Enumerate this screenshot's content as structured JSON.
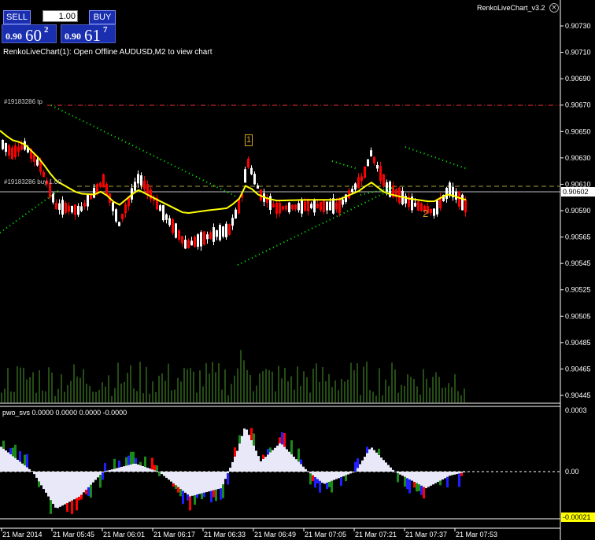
{
  "window": {
    "title": "RenkoLiveChart_v3.2",
    "close_icon": "close-icon"
  },
  "trade_panel": {
    "sell_label": "SELL",
    "buy_label": "BUY",
    "lot_value": "1.00",
    "sell_price": {
      "prefix": "0.90",
      "big": "60",
      "sup": "2"
    },
    "buy_price": {
      "prefix": "0.90",
      "big": "61",
      "sup": "7"
    }
  },
  "chart_info": "RenkoLiveChart(1): Open Offline AUDUSD,M2 to view chart",
  "order_labels": {
    "tp": "#19183286 tp",
    "buy": "#19183286 buy 1.00"
  },
  "wave_labels": {
    "one": "1",
    "two": "2"
  },
  "indicator_name": "pwo_svs 0.0000 0.0000 0.0000 -0.0000",
  "colors": {
    "background": "#000000",
    "bull": "#ffffff",
    "bear": "#ff0000",
    "ma": "#ffff00",
    "dots": "#00ff00",
    "tp_line": "#ff3030",
    "buy_line": "#b0a030",
    "current_price": "#ffffff",
    "volume": "#4a9a2a",
    "osc_body": "#e8e8f8",
    "osc_red": "#ff0000",
    "osc_blue": "#1f1fff",
    "osc_green": "#1a8a1a"
  },
  "chart_data": {
    "type": "candlestick",
    "ylim": [
      0.90445,
      0.9073
    ],
    "y_ticks": [
      "0.90730",
      "0.90710",
      "0.90690",
      "0.90670",
      "0.90650",
      "0.90630",
      "0.90610",
      "0.90590",
      "0.90565",
      "0.90545",
      "0.90525",
      "0.90505",
      "0.90485",
      "0.90465",
      "0.90445"
    ],
    "current_price": {
      "value": 0.90602,
      "label": "0.90602"
    },
    "tp_level": 0.9067,
    "buy_level": 0.90607,
    "x_labels": [
      "21 Mar 2014",
      "21 Mar 05:45",
      "21 Mar 06:01",
      "21 Mar 06:17",
      "21 Mar 06:33",
      "21 Mar 06:49",
      "21 Mar 07:05",
      "21 Mar 07:21",
      "21 Mar 07:37",
      "21 Mar 07:53"
    ],
    "indicator": {
      "name": "pwo_svs",
      "y_ticks": [
        "0.0003",
        "0.00"
      ],
      "current_label": "-0.00021"
    }
  }
}
